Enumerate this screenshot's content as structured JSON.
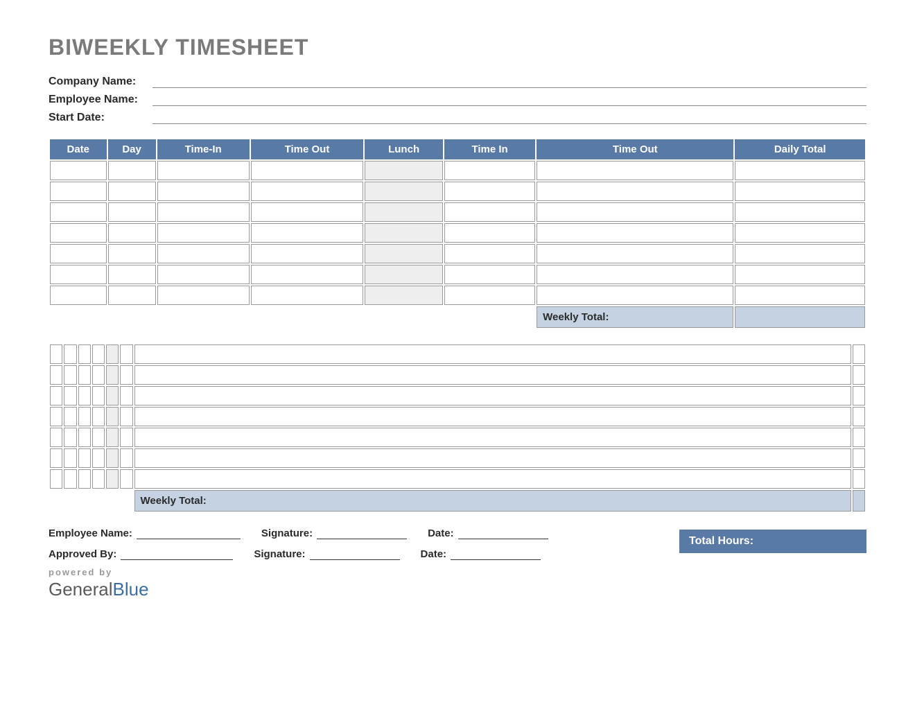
{
  "title": "BIWEEKLY TIMESHEET",
  "info": {
    "company_label": "Company Name:",
    "company_value": "",
    "employee_label": "Employee Name:",
    "employee_value": "",
    "startdate_label": "Start Date:",
    "startdate_value": ""
  },
  "columns": [
    "Date",
    "Day",
    "Time-In",
    "Time Out",
    "Lunch",
    "Time In",
    "Time Out",
    "Daily Total"
  ],
  "week1_rows": [
    {
      "date": "",
      "day": "",
      "time_in_am": "",
      "time_out_am": "",
      "lunch": "",
      "time_in_pm": "",
      "time_out_pm": "",
      "daily_total": ""
    },
    {
      "date": "",
      "day": "",
      "time_in_am": "",
      "time_out_am": "",
      "lunch": "",
      "time_in_pm": "",
      "time_out_pm": "",
      "daily_total": ""
    },
    {
      "date": "",
      "day": "",
      "time_in_am": "",
      "time_out_am": "",
      "lunch": "",
      "time_in_pm": "",
      "time_out_pm": "",
      "daily_total": ""
    },
    {
      "date": "",
      "day": "",
      "time_in_am": "",
      "time_out_am": "",
      "lunch": "",
      "time_in_pm": "",
      "time_out_pm": "",
      "daily_total": ""
    },
    {
      "date": "",
      "day": "",
      "time_in_am": "",
      "time_out_am": "",
      "lunch": "",
      "time_in_pm": "",
      "time_out_pm": "",
      "daily_total": ""
    },
    {
      "date": "",
      "day": "",
      "time_in_am": "",
      "time_out_am": "",
      "lunch": "",
      "time_in_pm": "",
      "time_out_pm": "",
      "daily_total": ""
    },
    {
      "date": "",
      "day": "",
      "time_in_am": "",
      "time_out_am": "",
      "lunch": "",
      "time_in_pm": "",
      "time_out_pm": "",
      "daily_total": ""
    }
  ],
  "week2_rows": [
    {
      "date": "",
      "day": "",
      "time_in_am": "",
      "time_out_am": "",
      "lunch": "",
      "time_in_pm": "",
      "time_out_pm": "",
      "daily_total": ""
    },
    {
      "date": "",
      "day": "",
      "time_in_am": "",
      "time_out_am": "",
      "lunch": "",
      "time_in_pm": "",
      "time_out_pm": "",
      "daily_total": ""
    },
    {
      "date": "",
      "day": "",
      "time_in_am": "",
      "time_out_am": "",
      "lunch": "",
      "time_in_pm": "",
      "time_out_pm": "",
      "daily_total": ""
    },
    {
      "date": "",
      "day": "",
      "time_in_am": "",
      "time_out_am": "",
      "lunch": "",
      "time_in_pm": "",
      "time_out_pm": "",
      "daily_total": ""
    },
    {
      "date": "",
      "day": "",
      "time_in_am": "",
      "time_out_am": "",
      "lunch": "",
      "time_in_pm": "",
      "time_out_pm": "",
      "daily_total": ""
    },
    {
      "date": "",
      "day": "",
      "time_in_am": "",
      "time_out_am": "",
      "lunch": "",
      "time_in_pm": "",
      "time_out_pm": "",
      "daily_total": ""
    },
    {
      "date": "",
      "day": "",
      "time_in_am": "",
      "time_out_am": "",
      "lunch": "",
      "time_in_pm": "",
      "time_out_pm": "",
      "daily_total": ""
    }
  ],
  "weekly_total_label": "Weekly Total:",
  "weekly_total_1": "",
  "weekly_total_2": "",
  "signatures": {
    "employee_name_label": "Employee Name:",
    "employee_name_value": "",
    "signature_label": "Signature:",
    "employee_signature_value": "",
    "date_label": "Date:",
    "employee_date_value": "",
    "approved_by_label": "Approved By:",
    "approved_by_value": "",
    "approver_signature_value": "",
    "approver_date_value": ""
  },
  "total_hours_label": "Total Hours:",
  "total_hours_value": "",
  "brand": {
    "powered": "powered by",
    "general": "General",
    "blue": "Blue"
  }
}
